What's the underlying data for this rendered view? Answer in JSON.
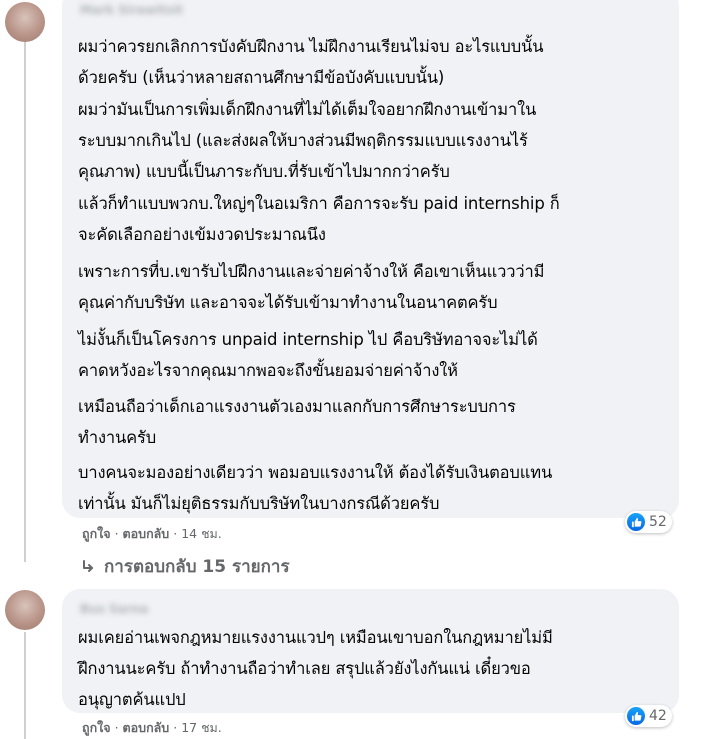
{
  "comments": [
    {
      "author": "Mark Sirawitsit",
      "paragraphs": [
        [
          "ผมว่าควรยกเลิกการบังคับฝึกงาน ไม่ฝึกงานเรียนไม่จบ อะไรแบบนั้น",
          "ด้วยครับ (เห็นว่าหลายสถานศึกษามีข้อบังคับแบบนั้น)"
        ],
        [
          "ผมว่ามันเป็นการเพิ่มเด็กฝึกงานที่ไม่ได้เต็มใจอยากฝึกงานเข้ามาใน",
          "ระบบมากเกินไป (และส่งผลให้บางส่วนมีพฤติกรรมแบบแรงงานไร้",
          "คุณภาพ) แบบนี้เป็นภาระกับบ.ที่รับเข้าไปมากกว่าครับ"
        ],
        [
          "แล้วก็ทำแบบพวกบ.ใหญ่ๆในอเมริกา คือการจะรับ paid internship ก็",
          "จะคัดเลือกอย่างเข้มงวดประมาณนึง"
        ],
        [
          "เพราะการที่บ.เขารับไปฝึกงานและจ่ายค่าจ้างให้ คือเขาเห็นแววว่ามี",
          "คุณค่ากับบริษัท และอาจจะได้รับเข้ามาทำงานในอนาคตครับ"
        ],
        [
          "ไม่งั้นก็เป็นโครงการ unpaid internship ไป คือบริษัทอาจจะไม่ได้",
          "คาดหวังอะไรจากคุณมากพอจะถึงขั้นยอมจ่ายค่าจ้างให้"
        ],
        [
          "เหมือนถือว่าเด็กเอาแรงงานตัวเองมาแลกกับการศึกษาระบบการ",
          "ทำงานครับ"
        ],
        [
          "บางคนจะมองอย่างเดียวว่า พอมอบแรงงานให้ ต้องได้รับเงินตอบแทน",
          "เท่านั้น มันก็ไม่ยุติธรรมกับบริษัทในบางกรณีด้วยครับ"
        ]
      ],
      "like_label": "ถูกใจ",
      "reply_label": "ตอบกลับ",
      "time": "14 ชม.",
      "reaction_count": "52"
    },
    {
      "author": "Bus Sarna",
      "paragraphs": [
        [
          "ผมเคยอ่านเพจกฎหมายแรงงานแวปๆ เหมือนเขาบอกในกฎหมายไม่มี",
          "ฝึกงานนะครับ ถ้าทำงานถือว่าทำเลย สรุปแล้วยังไงกันแน่ เดี๋ยวขอ",
          "อนุญาตค้นแปป"
        ]
      ],
      "like_label": "ถูกใจ",
      "reply_label": "ตอบกลับ",
      "time": "17 ชม.",
      "reaction_count": "42"
    }
  ],
  "replies_label": "การตอบกลับ 15 รายการ",
  "icons": {
    "reaction": "like-icon",
    "reply_arrow": "reply-arrow-icon"
  },
  "colors": {
    "bubble": "#f0f2f5",
    "like_blue": "#1877f2",
    "meta": "#65676b"
  }
}
